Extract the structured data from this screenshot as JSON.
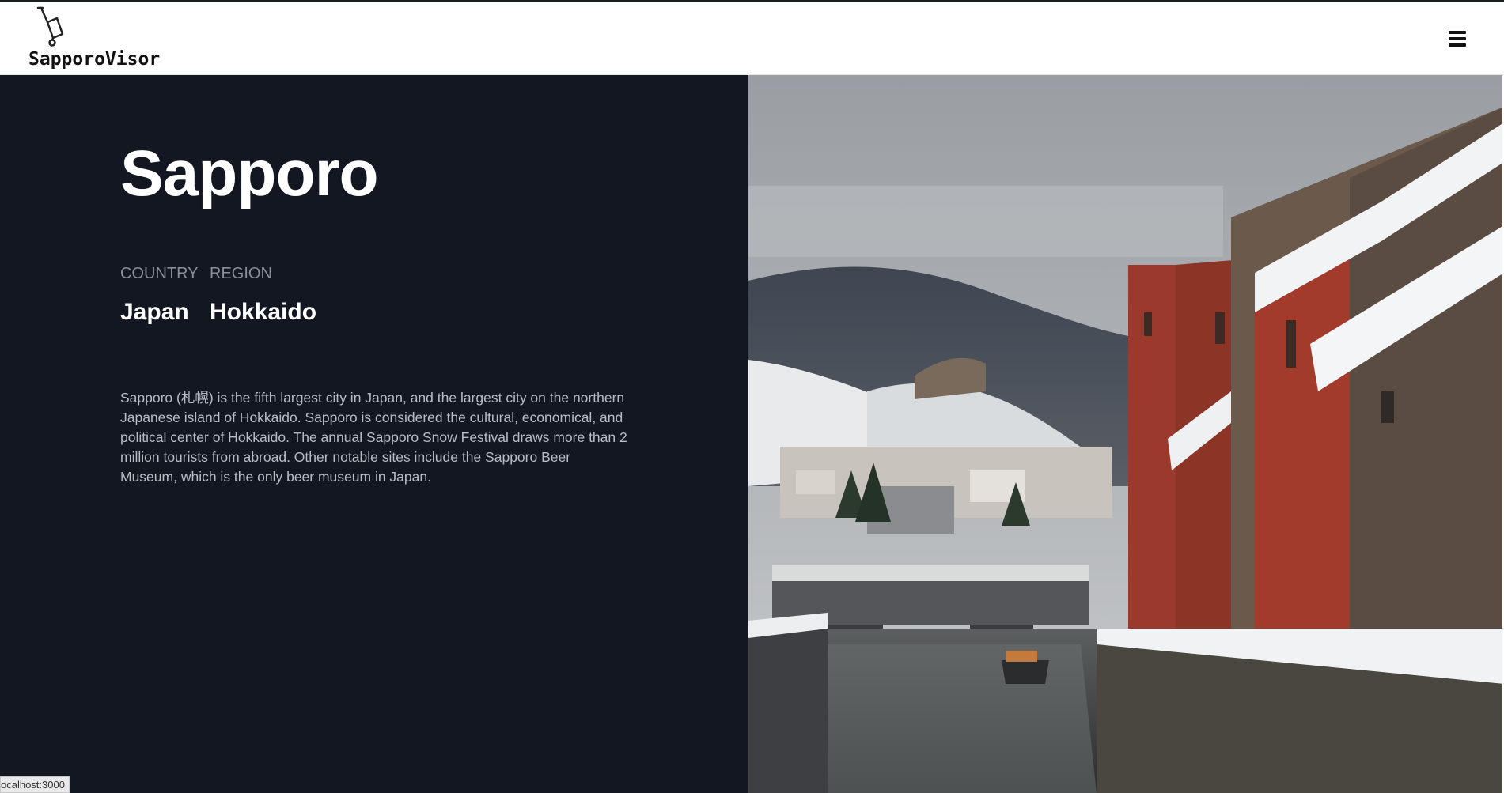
{
  "header": {
    "brand": "SapporoVisor",
    "logo_icon": "luggage-cart-icon",
    "menu_icon": "hamburger-menu-icon"
  },
  "city": {
    "name": "Sapporo",
    "country_label": "COUNTRY",
    "country": "Japan",
    "region_label": "REGION",
    "region": "Hokkaido",
    "description": "Sapporo (札幌) is the fifth largest city in Japan, and the largest city on the northern Japanese island of Hokkaido. Sapporo is considered the cultural, economical, and political center of Hokkaido. The annual Sapporo Snow Festival draws more than 2 million tourists from abroad. Other notable sites include the Sapporo Beer Museum, which is the only beer museum in Japan."
  },
  "status_bar": {
    "text": "ocalhost:3000"
  },
  "colors": {
    "panel_bg": "#131722",
    "header_bg": "#ffffff",
    "text_primary": "#ffffff",
    "text_muted": "#8a8f99",
    "text_body": "#b7bcc5"
  }
}
